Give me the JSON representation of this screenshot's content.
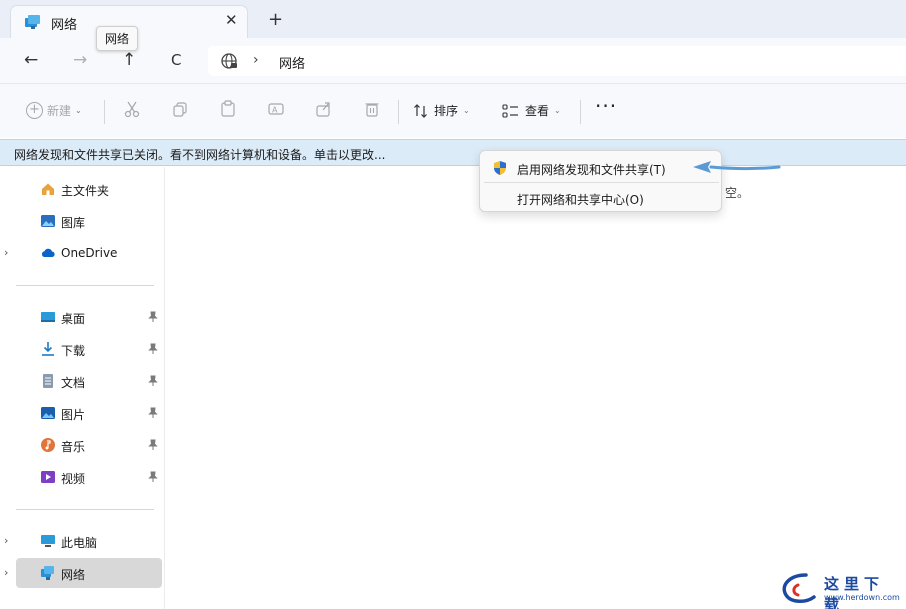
{
  "window": {
    "tab_title": "网络",
    "tab_close": "✕",
    "new_tab": "+",
    "tooltip": "网络"
  },
  "nav": {
    "back": "←",
    "forward": "→",
    "up": "↑",
    "refresh": "C",
    "crumb_separator": "›",
    "breadcrumb": "网络"
  },
  "toolbar": {
    "new_label": "新建",
    "sort_label": "排序",
    "view_label": "查看",
    "more_label": "···",
    "caret": "⌄"
  },
  "infobar": {
    "message": "网络发现和文件共享已关闭。看不到网络计算机和设备。单击以更改..."
  },
  "sidebar": {
    "items": [
      {
        "label": "主文件夹",
        "icon": "home-icon"
      },
      {
        "label": "图库",
        "icon": "gallery-icon"
      },
      {
        "label": "OneDrive",
        "icon": "cloud-icon",
        "expandable": true
      },
      {
        "label": "桌面",
        "icon": "desktop-icon",
        "pinned": true
      },
      {
        "label": "下载",
        "icon": "download-icon",
        "pinned": true
      },
      {
        "label": "文档",
        "icon": "document-icon",
        "pinned": true
      },
      {
        "label": "图片",
        "icon": "pictures-icon",
        "pinned": true
      },
      {
        "label": "音乐",
        "icon": "music-icon",
        "pinned": true
      },
      {
        "label": "视频",
        "icon": "video-icon",
        "pinned": true
      },
      {
        "label": "此电脑",
        "icon": "computer-icon",
        "expandable": true
      },
      {
        "label": "网络",
        "icon": "network-icon",
        "expandable": true,
        "selected": true
      }
    ],
    "chevron": "›",
    "pin_glyph": "📌"
  },
  "content": {
    "empty_text_fragment": "空。"
  },
  "context_menu": {
    "items": [
      {
        "label": "启用网络发现和文件共享(T)",
        "icon": "shield-icon"
      },
      {
        "label": "打开网络和共享中心(O)"
      }
    ]
  },
  "watermark": {
    "title": "这里下载",
    "url": "www.herdown.com"
  },
  "colors": {
    "accent": "#0067c0",
    "infobar_bg": "#dcebf8",
    "arrow": "#5b9bd5"
  }
}
